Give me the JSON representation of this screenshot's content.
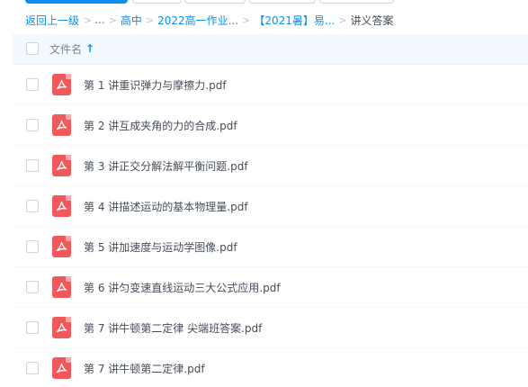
{
  "breadcrumb": {
    "back": "返回上一级",
    "ellipsis": "...",
    "items": [
      "高中",
      "2022高一作业...",
      "【2021暑】易..."
    ],
    "current": "讲义答案",
    "separator": ">"
  },
  "list_header": {
    "filename_label": "文件名",
    "sort_icon": "↑"
  },
  "files": [
    {
      "name": "第 1 讲重识弹力与摩擦力.pdf"
    },
    {
      "name": "第 2 讲互成夹角的力的合成.pdf"
    },
    {
      "name": "第 3 讲正交分解法解平衡问题.pdf"
    },
    {
      "name": "第 4 讲描述运动的基本物理量.pdf"
    },
    {
      "name": "第 5 讲加速度与运动学图像.pdf"
    },
    {
      "name": "第 6 讲匀变速直线运动三大公式应用.pdf"
    },
    {
      "name": "第 7 讲牛顿第二定律 尖端班答案.pdf"
    },
    {
      "name": "第 7 讲牛顿第二定律.pdf"
    }
  ],
  "colors": {
    "accent": "#0a8ff2",
    "pdf_icon": "#f0585c",
    "header_bg": "#f3f9fe"
  },
  "icons": {
    "file_type": "pdf-icon",
    "sort": "sort-ascending-icon"
  }
}
